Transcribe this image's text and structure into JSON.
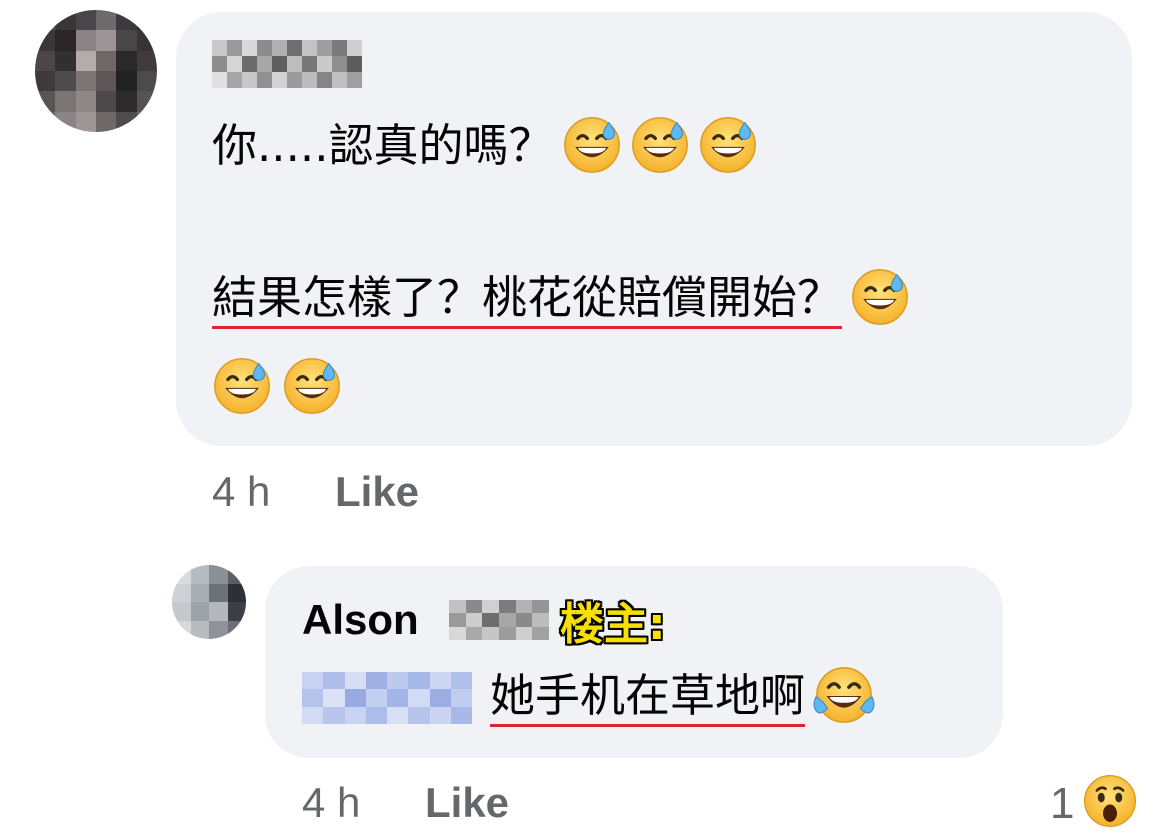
{
  "comment1": {
    "line1": "你.....認真的嗎？",
    "line2": "結果怎樣了？桃花從賠償開始？",
    "timestamp": "4 h",
    "like_label": "Like"
  },
  "comment2": {
    "author": "Alson",
    "op_tag": "楼主:",
    "text": "她手机在草地啊",
    "timestamp": "4 h",
    "like_label": "Like",
    "reaction_count": "1"
  },
  "icons": {
    "sweat_smile": "grinning-face-with-sweat-icon",
    "tears_of_joy": "face-with-tears-of-joy-icon",
    "wow": "wow-reaction-icon"
  },
  "colors": {
    "bubble": "#f0f2f5",
    "underline": "#e0242f",
    "meta_text": "#65676b",
    "op_tag": "#f7e000"
  }
}
